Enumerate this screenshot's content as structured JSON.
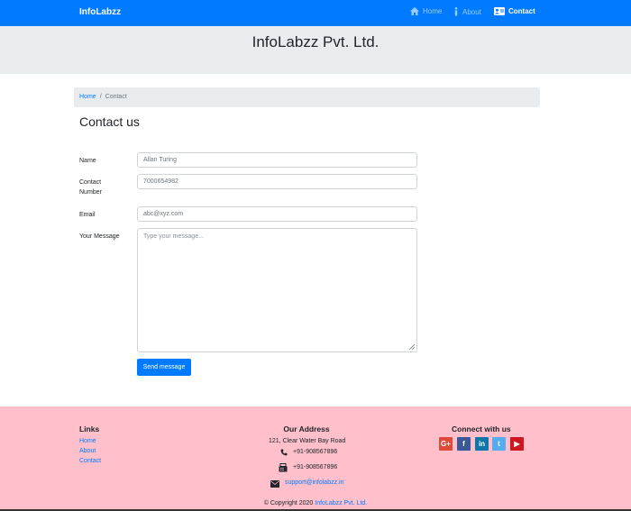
{
  "navbar": {
    "brand": "InfoLabzz",
    "items": [
      {
        "label": "Home",
        "icon": "home-icon"
      },
      {
        "label": "About",
        "icon": "info-icon"
      },
      {
        "label": "Contact",
        "icon": "contact-card-icon",
        "active": true
      }
    ]
  },
  "header": {
    "title": "InfoLabzz Pvt. Ltd."
  },
  "breadcrumb": {
    "home": "Home",
    "separator": "/",
    "current": "Contact"
  },
  "page": {
    "title": "Contact us"
  },
  "form": {
    "name_label": "Name",
    "name_value": "Allan Turing",
    "contact_label_line1": "Contact",
    "contact_label_line2": "Number",
    "contact_value": "7000654982",
    "email_label": "Email",
    "email_value": "abc@xyz.com",
    "message_label": "Your Message",
    "message_placeholder": "Type your message...",
    "submit_label": "Send message"
  },
  "footer": {
    "links_title": "Links",
    "links": [
      "Home",
      "About",
      "Contact"
    ],
    "address_title": "Our Address",
    "address": "121, Clear Water Bay Road",
    "phone": "+91-908567896",
    "fax": "+91-908567896",
    "email": "support@infolabzz.in",
    "connect_title": "Connect with us",
    "social": [
      {
        "icon": "google-plus-icon",
        "glyph": "G+",
        "color": "#dd4b39"
      },
      {
        "icon": "facebook-icon",
        "glyph": "f",
        "color": "#3b5998"
      },
      {
        "icon": "linkedin-icon",
        "glyph": "in",
        "color": "#0e76a8"
      },
      {
        "icon": "twitter-icon",
        "glyph": "t",
        "color": "#55acee"
      },
      {
        "icon": "youtube-icon",
        "glyph": "▶",
        "color": "#cc181e"
      }
    ],
    "copyright_prefix": "© Copyright 2020",
    "copyright_company": "InfoLabzz Pvt. Ltd."
  },
  "colors": {
    "primary": "#007bff",
    "footer_bg": "#ffc0cb",
    "jumbotron_bg": "#e9ecef"
  }
}
